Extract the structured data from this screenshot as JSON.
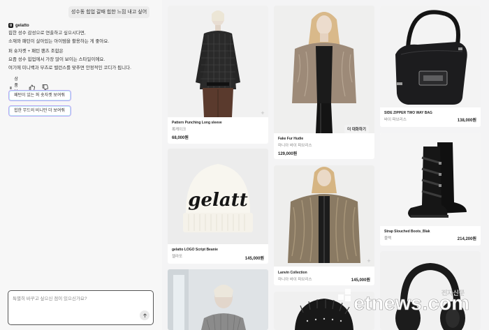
{
  "chat": {
    "user_message": "성수동 힙업 갈때 힙한 느낌 내고 싶어",
    "bot_name": "gelatto",
    "bot_lines": [
      "힙한 성수 감성으로 연출하고 싶으시다면,",
      "소재와 패턴이 살아있는 아이템을 활용하는 게 좋아요.",
      "퍼 숏자켓 + 패턴 팬츠 조합은",
      "요즘 성수 힙업에서 가장 많이 보이는 스타일이에요.",
      "여기에 미니백과 부츠로 밸런스를 맞추면 안정적인 코디가 됩니다."
    ],
    "view_products": "상품 보기",
    "chips": [
      "패턴이 있는 퍼 숏자켓 보여줘",
      "힙한 무드의 비니만 더 보여줘"
    ],
    "input_placeholder": "특별히 바꾸고 싶으신 점이 있으신가요?"
  },
  "products": {
    "p1": {
      "name": "Pattern Punching Long sleeve",
      "brand": "록케이크",
      "price": "68,000원"
    },
    "p2": {
      "name": "gelatto LOGO Script Beanie",
      "brand": "젤라또",
      "price": "145,000원",
      "beanie_text": "gelatt"
    },
    "p3": {
      "name": "Fake Fur Hudie",
      "brand": "마니아 바이 파브리스",
      "price": "129,000원",
      "badge": "더 대화하기"
    },
    "p4": {
      "name": "Lanvin Collection",
      "brand": "마니아 바이 파브리스",
      "price": "145,000원"
    },
    "p5": {
      "name": "SIDE ZIPPER TWO WAY BAG",
      "brand": "바이 파브리스",
      "price": "138,000원"
    },
    "p6": {
      "name": "Strap Slouched Boots_Blak",
      "brand": "블랙",
      "price": "214,200원"
    }
  },
  "watermark": {
    "text": "etnews.com",
    "sub": "전자신문"
  }
}
